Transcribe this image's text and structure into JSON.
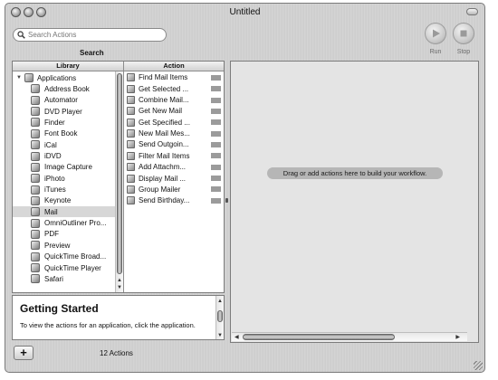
{
  "window": {
    "title": "Untitled"
  },
  "search": {
    "placeholder": "Search Actions",
    "label": "Search"
  },
  "toolbar": {
    "run_label": "Run",
    "stop_label": "Stop"
  },
  "library": {
    "header": "Library",
    "root": "Applications",
    "items": [
      {
        "label": "Address Book"
      },
      {
        "label": "Automator"
      },
      {
        "label": "DVD Player"
      },
      {
        "label": "Finder"
      },
      {
        "label": "Font Book"
      },
      {
        "label": "iCal"
      },
      {
        "label": "iDVD"
      },
      {
        "label": "Image Capture"
      },
      {
        "label": "iPhoto"
      },
      {
        "label": "iTunes"
      },
      {
        "label": "Keynote"
      },
      {
        "label": "Mail",
        "selected": true
      },
      {
        "label": "OmniOutliner Pro..."
      },
      {
        "label": "PDF"
      },
      {
        "label": "Preview"
      },
      {
        "label": "QuickTime Broad..."
      },
      {
        "label": "QuickTime Player"
      },
      {
        "label": "Safari"
      }
    ]
  },
  "actions": {
    "header": "Action",
    "items": [
      {
        "label": "Find Mail Items"
      },
      {
        "label": "Get Selected ..."
      },
      {
        "label": "Combine Mail..."
      },
      {
        "label": "Get New Mail"
      },
      {
        "label": "Get Specified ..."
      },
      {
        "label": "New Mail Mes..."
      },
      {
        "label": "Send Outgoin..."
      },
      {
        "label": "Filter Mail Items"
      },
      {
        "label": "Add Attachm..."
      },
      {
        "label": "Display Mail ..."
      },
      {
        "label": "Group Mailer"
      },
      {
        "label": "Send Birthday..."
      }
    ]
  },
  "description": {
    "title": "Getting Started",
    "text": "To view the actions for an application, click the application."
  },
  "workflow": {
    "placeholder": "Drag or add actions here to build your workflow."
  },
  "footer": {
    "add_label": "+",
    "count": "12 Actions"
  }
}
